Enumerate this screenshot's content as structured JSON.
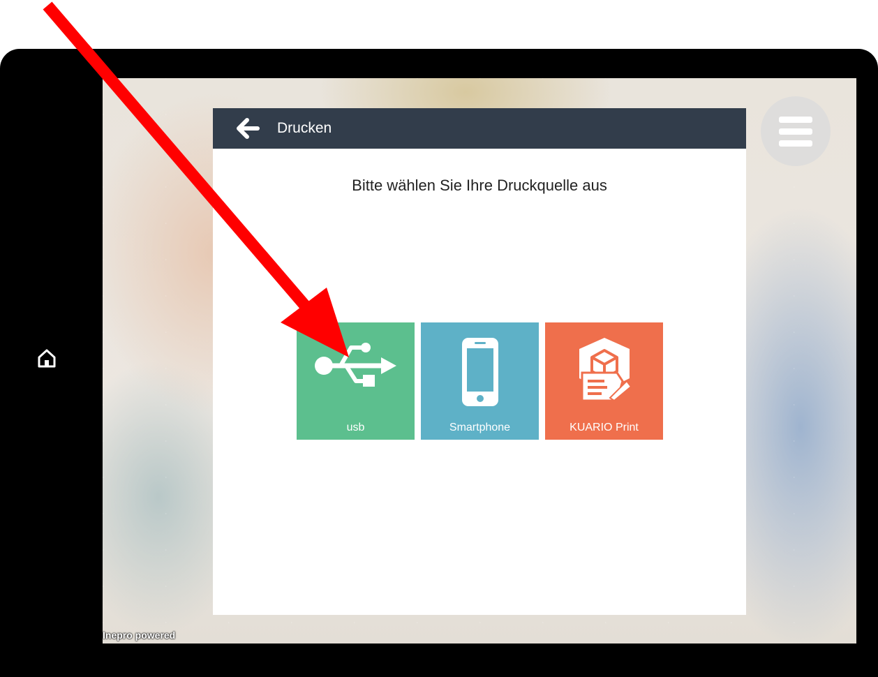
{
  "header": {
    "title": "Drucken"
  },
  "main": {
    "prompt": "Bitte wählen Sie Ihre Druckquelle aus"
  },
  "sources": [
    {
      "label": "usb",
      "icon": "usb-icon",
      "color": "#5cbf8e"
    },
    {
      "label": "Smartphone",
      "icon": "smartphone-icon",
      "color": "#5eb1c7"
    },
    {
      "label": "KUARIO Print",
      "icon": "kuario-print-icon",
      "color": "#ef6f4c"
    }
  ],
  "footer": {
    "text": "Inepro powered"
  },
  "colors": {
    "header_bg": "#323d4b",
    "annotation_arrow": "#ff0000"
  },
  "annotation": {
    "type": "arrow",
    "target": "usb-tile"
  }
}
